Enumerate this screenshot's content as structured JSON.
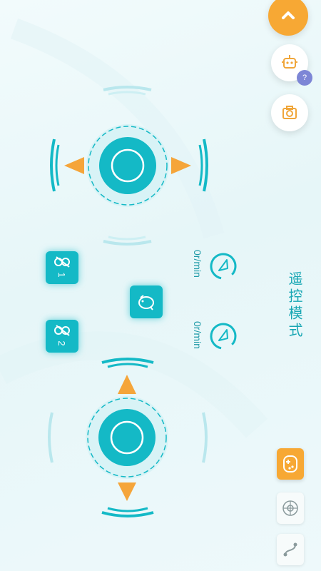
{
  "header": {
    "collapse_icon": "chevron-up-icon",
    "robot_icon": "robot-icon",
    "help_badge": "?",
    "camera_icon": "camera-icon"
  },
  "mode_title": "遥控模式",
  "speed": {
    "motor1_rpm": "0r/min",
    "motor2_rpm": "0r/min"
  },
  "motor_buttons": [
    {
      "label": "1",
      "icon": "motor-icon"
    },
    {
      "label": "2",
      "icon": "motor-icon"
    }
  ],
  "center_icon": "piggy-icon",
  "mode_tabs": [
    {
      "icon": "gamepad-icon",
      "active": true
    },
    {
      "icon": "network-icon",
      "active": false
    },
    {
      "icon": "path-icon",
      "active": false
    }
  ],
  "colors": {
    "accent": "#14b9c6",
    "orange": "#f7a834",
    "text": "#19a7b4"
  }
}
